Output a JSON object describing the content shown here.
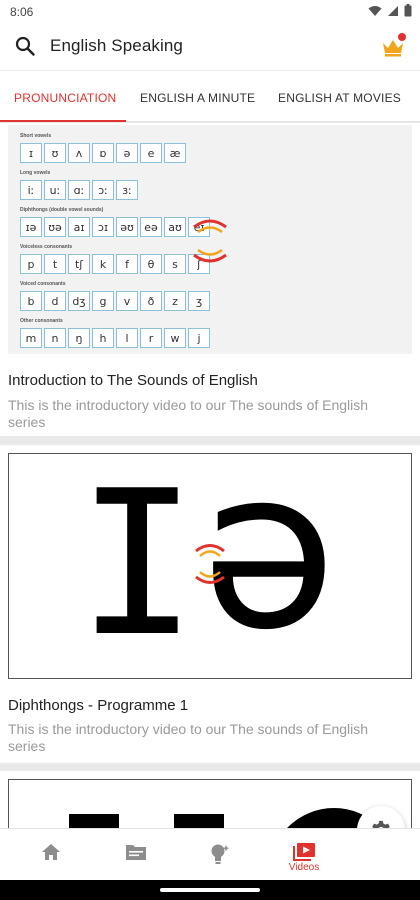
{
  "status_bar": {
    "time": "8:06",
    "icons": [
      "wifi-icon",
      "signal-icon",
      "battery-icon"
    ]
  },
  "app_bar": {
    "title": "English Speaking",
    "icons": [
      "search-icon",
      "crown-icon"
    ],
    "accent": "#e0322f",
    "crown_color": "#f2a51b"
  },
  "tabs": [
    {
      "label": "PRONUNCIATION",
      "active": true
    },
    {
      "label": "ENGLISH A MINUTE",
      "active": false
    },
    {
      "label": "ENGLISH AT MOVIES",
      "active": false
    }
  ],
  "videos": [
    {
      "title": "Introduction to The Sounds of English",
      "description": "This is the introductory video to our The sounds of English series",
      "thumbnail": {
        "sections": [
          {
            "label": "Short vowels",
            "symbols": [
              "ɪ",
              "ʊ",
              "ʌ",
              "ɒ",
              "ə",
              "e",
              "æ"
            ]
          },
          {
            "label": "Long vowels",
            "symbols": [
              "iː",
              "uː",
              "ɑː",
              "ɔː",
              "ɜː"
            ]
          },
          {
            "label": "Diphthongs (double vowel sounds)",
            "symbols": [
              "ɪə",
              "ʊə",
              "aɪ",
              "ɔɪ",
              "əʊ",
              "eə",
              "aʊ",
              "eɪ"
            ]
          },
          {
            "label": "Voiceless consonants",
            "symbols": [
              "p",
              "t",
              "tʃ",
              "k",
              "f",
              "θ",
              "s",
              "ʃ"
            ]
          },
          {
            "label": "Voiced consonants",
            "symbols": [
              "b",
              "d",
              "dʒ",
              "g",
              "v",
              "ð",
              "z",
              "ʒ"
            ]
          },
          {
            "label": "Other consonants",
            "symbols": [
              "m",
              "n",
              "ŋ",
              "h",
              "l",
              "r",
              "w",
              "j"
            ]
          }
        ]
      }
    },
    {
      "title": "Diphthongs - Programme 1",
      "description": "This is the introductory video to our The sounds of English series",
      "thumbnail": {
        "symbols": [
          "I",
          "ə"
        ]
      }
    },
    {
      "title": "",
      "description": "",
      "thumbnail": {}
    }
  ],
  "fab": {
    "icon": "gear-icon"
  },
  "bottom_nav": [
    {
      "icon": "home-icon",
      "label": "",
      "active": false
    },
    {
      "icon": "folder-icon",
      "label": "",
      "active": false
    },
    {
      "icon": "lightbulb-icon",
      "label": "",
      "active": false
    },
    {
      "icon": "play-video-icon",
      "label": "Videos",
      "active": true
    },
    {
      "icon": "",
      "label": "",
      "active": false
    }
  ]
}
